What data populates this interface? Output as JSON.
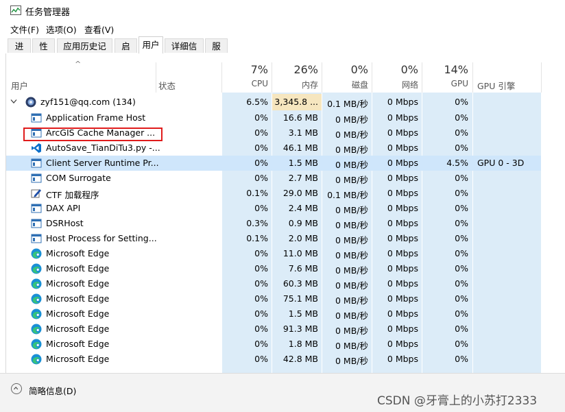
{
  "window": {
    "title": "任务管理器"
  },
  "menu": [
    "文件(F)",
    "选项(O)",
    "查看(V)"
  ],
  "tabs": [
    "进程",
    "性能",
    "应用历史记录",
    "启动",
    "用户",
    "详细信息",
    "服务"
  ],
  "active_tab": "用户",
  "columns": {
    "user": "用户",
    "status": "状态",
    "cpu": {
      "pct": "7%",
      "label": "CPU"
    },
    "memory": {
      "pct": "26%",
      "label": "内存"
    },
    "disk": {
      "pct": "0%",
      "label": "磁盘"
    },
    "network": {
      "pct": "0%",
      "label": "网络"
    },
    "gpu": {
      "pct": "14%",
      "label": "GPU"
    },
    "gpu_engine": "GPU 引擎"
  },
  "group": {
    "name": "zyf151@qq.com (134)",
    "cpu": "6.5%",
    "memory": "3,345.8 ...",
    "disk": "0.1 MB/秒",
    "network": "0 Mbps",
    "gpu": "0%",
    "gpu_engine": ""
  },
  "rows": [
    {
      "icon": "app-window-icon",
      "name": "Application Frame Host",
      "cpu": "0%",
      "memory": "16.6 MB",
      "disk": "0 MB/秒",
      "network": "0 Mbps",
      "gpu": "0%",
      "gpu_engine": ""
    },
    {
      "icon": "app-window-icon",
      "name": "ArcGIS Cache Manager ...",
      "cpu": "0%",
      "memory": "3.1 MB",
      "disk": "0 MB/秒",
      "network": "0 Mbps",
      "gpu": "0%",
      "gpu_engine": ""
    },
    {
      "icon": "vscode-icon",
      "name": "AutoSave_TianDiTu3.py -...",
      "cpu": "0%",
      "memory": "46.1 MB",
      "disk": "0 MB/秒",
      "network": "0 Mbps",
      "gpu": "0%",
      "gpu_engine": ""
    },
    {
      "icon": "app-window-icon",
      "name": "Client Server Runtime Pr...",
      "cpu": "0%",
      "memory": "1.5 MB",
      "disk": "0 MB/秒",
      "network": "0 Mbps",
      "gpu": "4.5%",
      "gpu_engine": "GPU 0 - 3D"
    },
    {
      "icon": "app-window-icon",
      "name": "COM Surrogate",
      "cpu": "0%",
      "memory": "2.7 MB",
      "disk": "0 MB/秒",
      "network": "0 Mbps",
      "gpu": "0%",
      "gpu_engine": ""
    },
    {
      "icon": "ctf-pen-icon",
      "name": "CTF 加载程序",
      "cpu": "0.1%",
      "memory": "29.0 MB",
      "disk": "0.1 MB/秒",
      "network": "0 Mbps",
      "gpu": "0%",
      "gpu_engine": ""
    },
    {
      "icon": "app-window-icon",
      "name": "DAX API",
      "cpu": "0%",
      "memory": "2.4 MB",
      "disk": "0 MB/秒",
      "network": "0 Mbps",
      "gpu": "0%",
      "gpu_engine": ""
    },
    {
      "icon": "app-window-icon",
      "name": "DSRHost",
      "cpu": "0.3%",
      "memory": "0.9 MB",
      "disk": "0 MB/秒",
      "network": "0 Mbps",
      "gpu": "0%",
      "gpu_engine": ""
    },
    {
      "icon": "app-window-icon",
      "name": "Host Process for Setting...",
      "cpu": "0.1%",
      "memory": "2.0 MB",
      "disk": "0 MB/秒",
      "network": "0 Mbps",
      "gpu": "0%",
      "gpu_engine": ""
    },
    {
      "icon": "edge-icon",
      "name": "Microsoft Edge",
      "cpu": "0%",
      "memory": "11.0 MB",
      "disk": "0 MB/秒",
      "network": "0 Mbps",
      "gpu": "0%",
      "gpu_engine": ""
    },
    {
      "icon": "edge-icon",
      "name": "Microsoft Edge",
      "cpu": "0%",
      "memory": "7.6 MB",
      "disk": "0 MB/秒",
      "network": "0 Mbps",
      "gpu": "0%",
      "gpu_engine": ""
    },
    {
      "icon": "edge-icon",
      "name": "Microsoft Edge",
      "cpu": "0%",
      "memory": "60.3 MB",
      "disk": "0 MB/秒",
      "network": "0 Mbps",
      "gpu": "0%",
      "gpu_engine": ""
    },
    {
      "icon": "edge-icon",
      "name": "Microsoft Edge",
      "cpu": "0%",
      "memory": "75.1 MB",
      "disk": "0 MB/秒",
      "network": "0 Mbps",
      "gpu": "0%",
      "gpu_engine": ""
    },
    {
      "icon": "edge-icon",
      "name": "Microsoft Edge",
      "cpu": "0%",
      "memory": "1.5 MB",
      "disk": "0 MB/秒",
      "network": "0 Mbps",
      "gpu": "0%",
      "gpu_engine": ""
    },
    {
      "icon": "edge-icon",
      "name": "Microsoft Edge",
      "cpu": "0%",
      "memory": "91.3 MB",
      "disk": "0 MB/秒",
      "network": "0 Mbps",
      "gpu": "0%",
      "gpu_engine": ""
    },
    {
      "icon": "edge-icon",
      "name": "Microsoft Edge",
      "cpu": "0%",
      "memory": "1.8 MB",
      "disk": "0 MB/秒",
      "network": "0 Mbps",
      "gpu": "0%",
      "gpu_engine": ""
    },
    {
      "icon": "edge-icon",
      "name": "Microsoft Edge",
      "cpu": "0%",
      "memory": "42.8 MB",
      "disk": "0 MB/秒",
      "network": "0 Mbps",
      "gpu": "0%",
      "gpu_engine": ""
    }
  ],
  "bottom": {
    "details_label": "简略信息(D)"
  },
  "watermark": "CSDN @牙膏上的小苏打2333",
  "colors": {
    "heat_light": "#dcecf8",
    "heat_medium": "#fcefd2",
    "selected": "#cce8ff",
    "highlight_box": "#e01b1b"
  }
}
